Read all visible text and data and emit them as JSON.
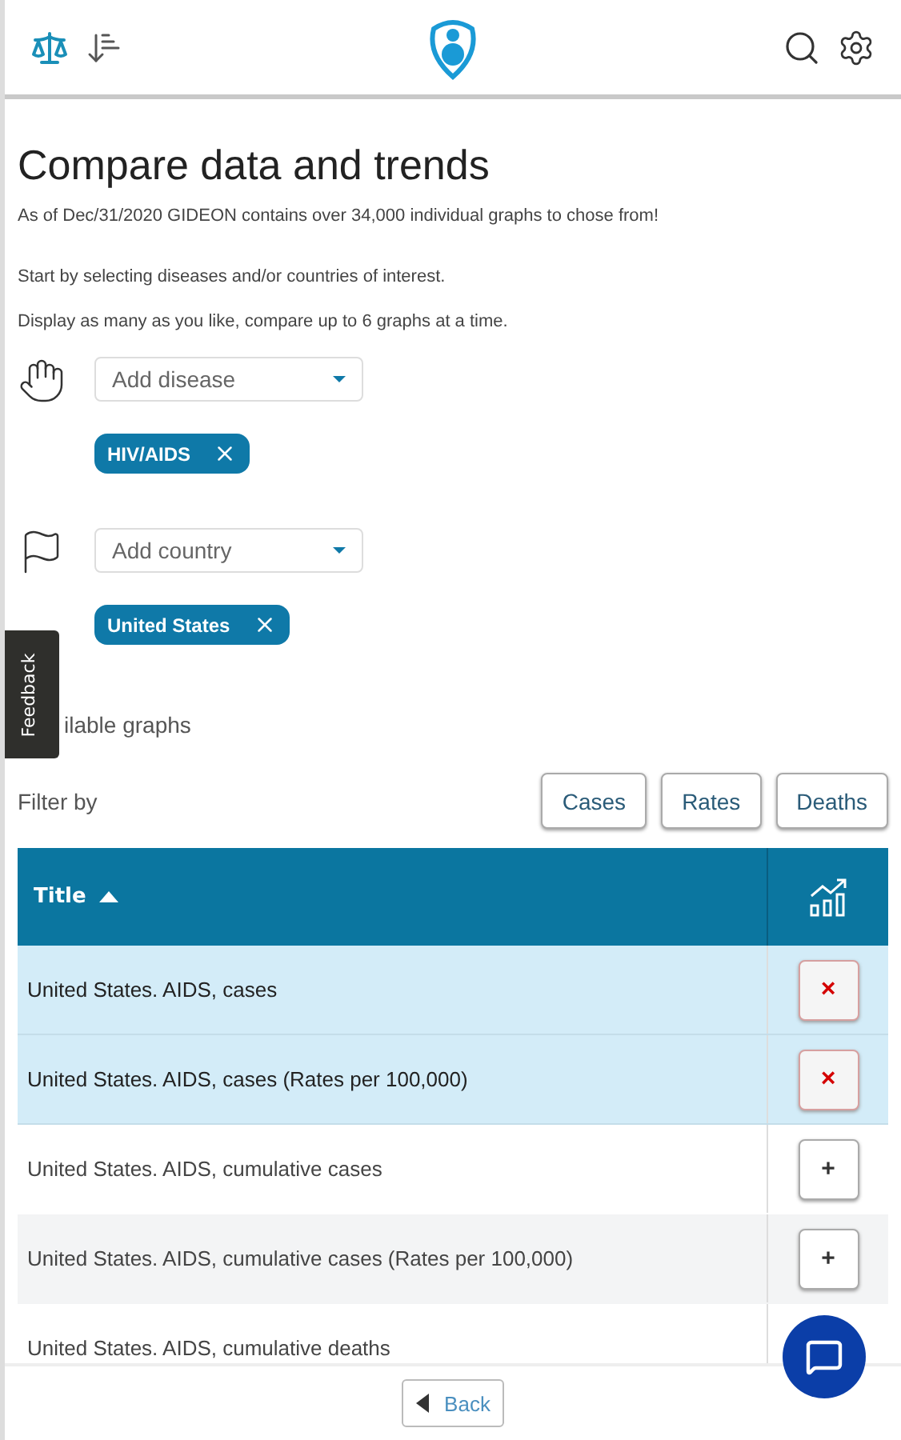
{
  "page": {
    "title": "Compare data and trends",
    "intro": "As of Dec/31/2020 GIDEON contains over 34,000 individual graphs to chose from!",
    "hints": [
      "Start by selecting diseases and/or countries of interest.",
      "Display as many as you like, compare up to 6 graphs at a time."
    ]
  },
  "pickers": [
    {
      "kind": "disease",
      "placeholder": "Add disease",
      "chips": [
        "HIV/AIDS"
      ]
    },
    {
      "kind": "country",
      "placeholder": "Add country",
      "chips": [
        "United States"
      ]
    }
  ],
  "feedback_tab": "Feedback",
  "available_label": "ilable graphs",
  "filter": {
    "label": "Filter by",
    "buttons": [
      "Cases",
      "Rates",
      "Deaths"
    ]
  },
  "table": {
    "columns": [
      "Title"
    ],
    "rows": [
      {
        "title": "United States. AIDS, cases",
        "selected": true,
        "action": "×"
      },
      {
        "title": "United States. AIDS, cases (Rates per 100,000)",
        "selected": true,
        "action": "×"
      },
      {
        "title": "United States. AIDS, cumulative cases",
        "selected": false,
        "action": "+"
      },
      {
        "title": "United States. AIDS, cumulative cases (Rates per 100,000)",
        "selected": false,
        "action": "+"
      },
      {
        "title": "United States. AIDS, cumulative deaths",
        "selected": false
      }
    ]
  },
  "footer": {
    "back": "Back"
  }
}
